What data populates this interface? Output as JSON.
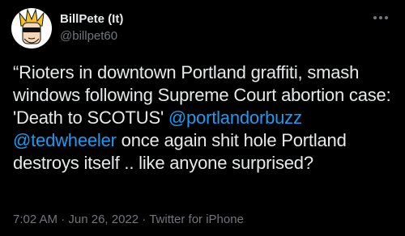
{
  "user": {
    "display_name": "BillPete (It)",
    "handle": "@billpet60",
    "avatar_icon": "cartoon-character-avatar"
  },
  "menu": {
    "icon": "more-horizontal-icon"
  },
  "tweet": {
    "text_1": "“Rioters in downtown Portland graffiti, smash windows following Supreme Court abortion case: 'Death to SCOTUS' ",
    "mention_1": "@portlandorbuzz",
    "space_1": " ",
    "mention_2": "@tedwheeler",
    "text_2": " once again shit hole Portland destroys itself .. like anyone surprised?"
  },
  "meta": {
    "time": "7:02 AM",
    "sep_1": " · ",
    "date": "Jun 26, 2022",
    "sep_2": " · ",
    "source": "Twitter for iPhone"
  },
  "colors": {
    "background": "#000000",
    "text": "#e7e9ea",
    "secondary": "#71767b",
    "link": "#1d9bf0"
  }
}
